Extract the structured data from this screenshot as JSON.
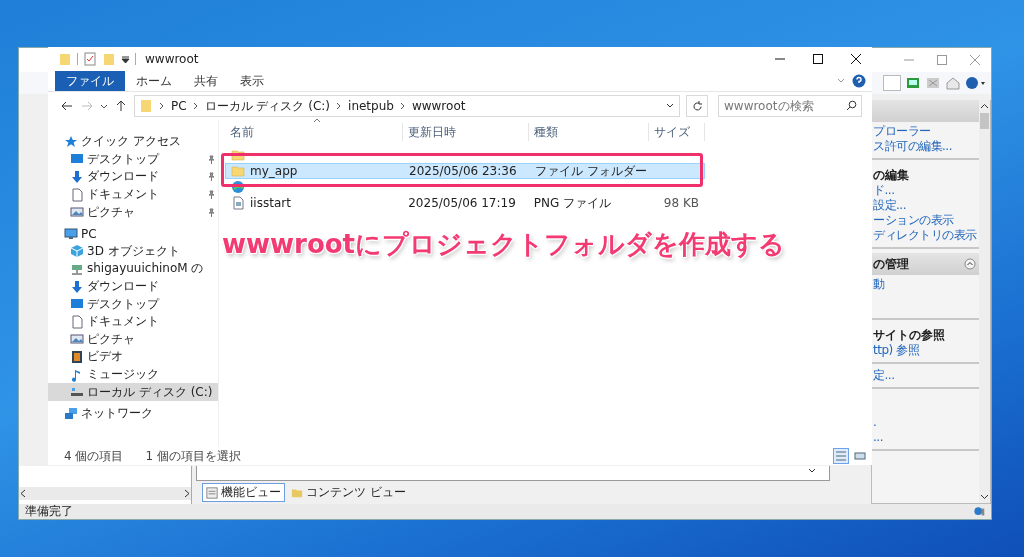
{
  "iis": {
    "toolbar_field": {
      "kind": "field"
    },
    "actions": [
      {
        "kind": "band"
      },
      {
        "kind": "link",
        "label": "プローラー"
      },
      {
        "kind": "link",
        "label": "ス許可の編集..."
      },
      {
        "kind": "separator"
      },
      {
        "kind": "title",
        "label": "の編集"
      },
      {
        "kind": "link",
        "label": "ド..."
      },
      {
        "kind": "link",
        "label": "設定..."
      },
      {
        "kind": "link",
        "label": "ーションの表示"
      },
      {
        "kind": "link",
        "label": "ディレクトリの表示"
      },
      {
        "kind": "separator"
      },
      {
        "kind": "band",
        "label": "の管理"
      },
      {
        "kind": "link",
        "label": "動"
      },
      {
        "kind": "gap"
      },
      {
        "kind": "separator"
      },
      {
        "kind": "title",
        "label": "サイトの参照"
      },
      {
        "kind": "link",
        "label": "ttp) 参照"
      },
      {
        "kind": "separator"
      },
      {
        "kind": "link",
        "label": "定..."
      },
      {
        "kind": "separator"
      },
      {
        "kind": "gap"
      },
      {
        "kind": "link",
        "label": "."
      },
      {
        "kind": "link",
        "label": "..."
      },
      {
        "kind": "separator"
      }
    ],
    "view_tabs": [
      {
        "label": "機能ビュー",
        "selected": true
      },
      {
        "label": "コンテンツ ビュー",
        "selected": false
      }
    ],
    "status": "準備完了"
  },
  "explorer": {
    "title": "wwwroot",
    "ribbon_tabs": [
      {
        "label": "ファイル",
        "kind": "file"
      },
      {
        "label": "ホーム",
        "kind": "tab"
      },
      {
        "label": "共有",
        "kind": "tab"
      },
      {
        "label": "表示",
        "kind": "tab"
      }
    ],
    "breadcrumbs": [
      "PC",
      "ローカル ディスク (C:)",
      "inetpub",
      "wwwroot"
    ],
    "search": {
      "placeholder": "wwwrootの検索"
    },
    "nav": [
      {
        "label": "クイック アクセス",
        "selected": false,
        "children": [
          {
            "label": "デスクトップ",
            "pinned": true,
            "selected": false
          },
          {
            "label": "ダウンロード",
            "pinned": true,
            "selected": false
          },
          {
            "label": "ドキュメント",
            "pinned": true,
            "selected": false
          },
          {
            "label": "ピクチャ",
            "pinned": true,
            "selected": false
          }
        ]
      },
      {
        "label": "PC",
        "selected": false,
        "children": [
          {
            "label": "3D オブジェクト",
            "selected": false
          },
          {
            "label": "shigayuuichinoM の",
            "selected": false
          },
          {
            "label": "ダウンロード",
            "selected": false
          },
          {
            "label": "デスクトップ",
            "selected": false
          },
          {
            "label": "ドキュメント",
            "selected": false
          },
          {
            "label": "ピクチャ",
            "selected": false
          },
          {
            "label": "ビデオ",
            "selected": false
          },
          {
            "label": "ミュージック",
            "selected": false
          },
          {
            "label": "ローカル ディスク (C:)",
            "selected": true
          }
        ]
      },
      {
        "label": "ネットワーク",
        "selected": false
      }
    ],
    "columns": [
      "名前",
      "更新日時",
      "種類",
      "サイズ"
    ],
    "rows": [
      {
        "kind": "obscured",
        "selected": false
      },
      {
        "kind": "file",
        "name": "my_app",
        "modified": "2025/05/06 23:36",
        "type": "ファイル フォルダー",
        "selected": true
      },
      {
        "kind": "obscured",
        "selected": false
      },
      {
        "kind": "file",
        "name": "iisstart",
        "modified": "2025/05/06 17:19",
        "type": "PNG ファイル",
        "size": "98 KB",
        "selected": false
      }
    ],
    "status": [
      "4 個の項目",
      "1 個の項目を選択"
    ],
    "view_buttons": [
      {
        "kind": "details",
        "selected": true
      },
      {
        "kind": "tiles",
        "selected": false
      }
    ]
  },
  "annotation": {
    "caption": "wwwrootにプロジェクトフォルダを作成する"
  }
}
